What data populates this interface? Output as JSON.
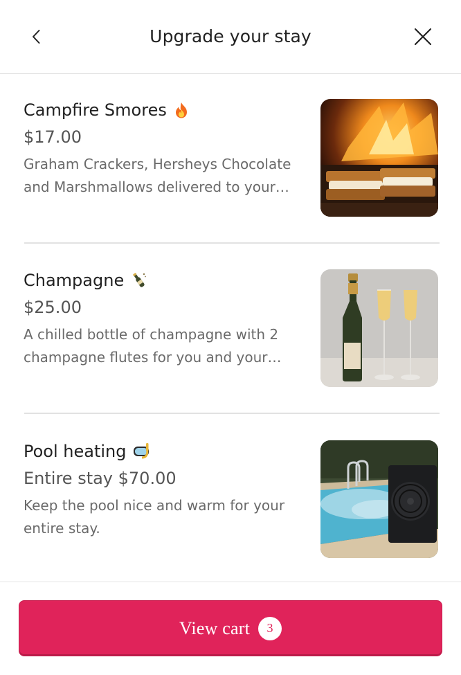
{
  "header": {
    "title": "Upgrade your stay",
    "back_icon": "chevron-left-icon",
    "close_icon": "close-icon"
  },
  "items": [
    {
      "name": "Campfire Smores",
      "emoji": "fire-emoji",
      "price": "$17.00",
      "description": "Graham Crackers, Hersheys Chocolate and Marshmallows delivered to your door."
    },
    {
      "name": "Champagne",
      "emoji": "champagne-bottle-emoji",
      "price": "$25.00",
      "description": "A chilled bottle of champagne with 2 champagne flutes for you and your partner."
    },
    {
      "name": "Pool heating",
      "emoji": "diving-mask-emoji",
      "price": "Entire stay $70.00",
      "description": "Keep the pool nice and warm for your entire stay."
    }
  ],
  "cart": {
    "label": "View cart",
    "count": "3"
  },
  "colors": {
    "accent": "#e0235a",
    "text_primary": "#222222",
    "text_secondary": "#6a6a6a",
    "divider": "#e2e2e2"
  }
}
